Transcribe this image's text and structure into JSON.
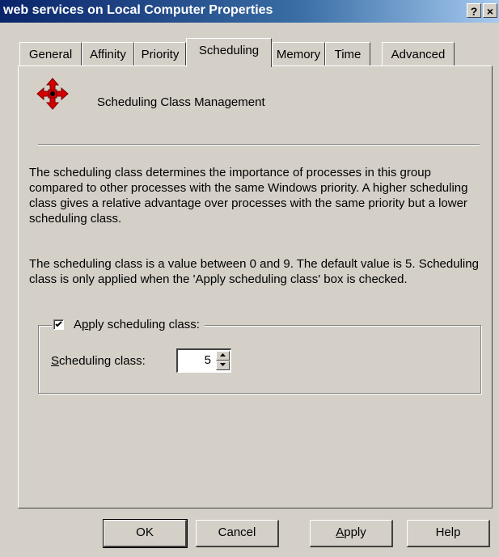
{
  "window": {
    "title": "web services on Local Computer Properties",
    "help_button": "?",
    "close_button": "×"
  },
  "tabs": [
    {
      "label": "General"
    },
    {
      "label": "Affinity"
    },
    {
      "label": "Priority"
    },
    {
      "label": "Scheduling",
      "active": true
    },
    {
      "label": "Memory"
    },
    {
      "label": "Time"
    },
    {
      "label": "Advanced"
    }
  ],
  "page": {
    "heading": "Scheduling Class Management",
    "icon": "four-arrows-icon",
    "paragraph1": "The scheduling class determines the importance of processes in this group compared to other processes with the same Windows priority.  A higher scheduling class gives a relative advantage over processes with the same priority but a lower scheduling class.",
    "paragraph2": "The scheduling class is a value between 0 and 9.  The default value is 5.  Scheduling class is only applied when the 'Apply scheduling class' box is checked.",
    "apply_checkbox": {
      "label_prefix": "A",
      "label_access": "p",
      "label_rest": "ply scheduling class:",
      "checked": true
    },
    "scheduling_class": {
      "label_access": "S",
      "label_rest": "cheduling class:",
      "value": "5"
    }
  },
  "buttons": {
    "ok": "OK",
    "cancel": "Cancel",
    "apply_access": "A",
    "apply_rest": "pply",
    "help": "Help"
  },
  "colors": {
    "icon_red": "#d40000",
    "titlebar": "#0a246a"
  }
}
